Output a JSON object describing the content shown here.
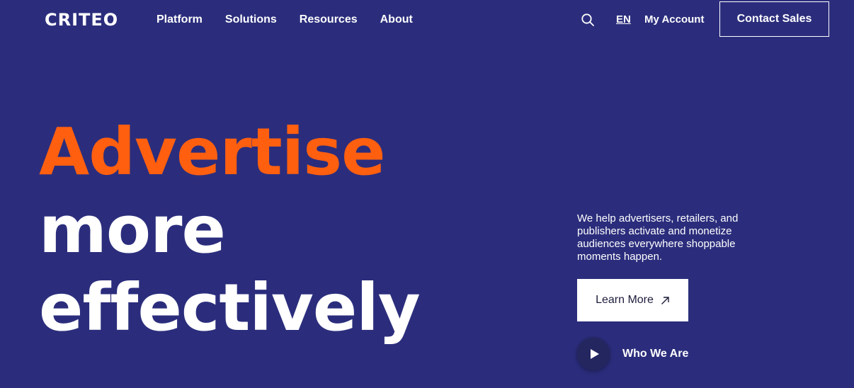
{
  "brand": {
    "logo_text": "CRITEO",
    "background_color": "#2b2d7c",
    "accent_color": "#ff5f0f"
  },
  "header": {
    "nav": [
      {
        "label": "Platform"
      },
      {
        "label": "Solutions"
      },
      {
        "label": "Resources"
      },
      {
        "label": "About"
      }
    ],
    "search_icon": "search-icon",
    "language": "EN",
    "account_label": "My Account",
    "contact_label": "Contact Sales"
  },
  "hero": {
    "title_lines": [
      "Advertise",
      "more",
      "effectively"
    ],
    "description": "We help advertisers, retailers, and publishers activate and monetize audiences everywhere shoppable moments happen.",
    "cta_label": "Learn More",
    "cta_icon": "arrow-up-right-icon",
    "video_label": "Who We Are",
    "video_icon": "play-icon"
  }
}
